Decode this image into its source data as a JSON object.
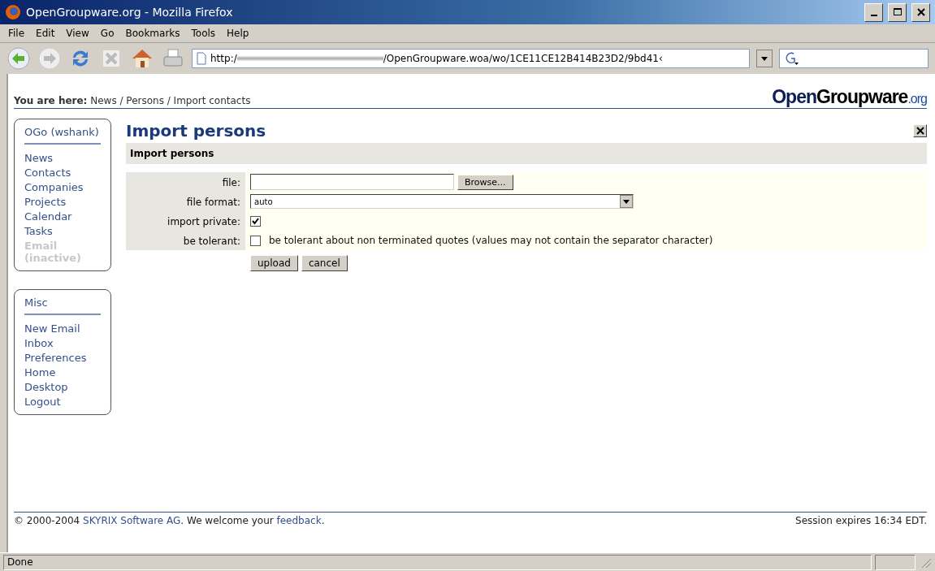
{
  "window": {
    "title": "OpenGroupware.org - Mozilla Firefox"
  },
  "menu": [
    "File",
    "Edit",
    "View",
    "Go",
    "Bookmarks",
    "Tools",
    "Help"
  ],
  "address": {
    "prefix": "http:/",
    "suffix": "/OpenGroupware.woa/wo/1CE11CE12B414B23D2/9bd41‹"
  },
  "breadcrumb": {
    "label": "You are here:",
    "path": "News / Persons / Import contacts"
  },
  "logo": [
    "Open",
    "Groupware",
    ".org"
  ],
  "sidebar": [
    {
      "title": "OGo (wshank)",
      "items": [
        {
          "label": "News",
          "disabled": false
        },
        {
          "label": "Contacts",
          "disabled": false
        },
        {
          "label": "Companies",
          "disabled": false
        },
        {
          "label": "Projects",
          "disabled": false
        },
        {
          "label": "Calendar",
          "disabled": false
        },
        {
          "label": "Tasks",
          "disabled": false
        },
        {
          "label": "Email (inactive)",
          "disabled": true
        }
      ]
    },
    {
      "title": "Misc",
      "items": [
        {
          "label": "New Email",
          "disabled": false
        },
        {
          "label": "Inbox",
          "disabled": false
        },
        {
          "label": "Preferences",
          "disabled": false
        },
        {
          "label": "Home",
          "disabled": false
        },
        {
          "label": "Desktop",
          "disabled": false
        },
        {
          "label": "Logout",
          "disabled": false
        }
      ]
    }
  ],
  "page": {
    "title": "Import persons",
    "section": "Import persons"
  },
  "form": [
    {
      "kind": "file",
      "label": "file:",
      "button": "Browse..."
    },
    {
      "kind": "select",
      "label": "file format:",
      "value": "auto"
    },
    {
      "kind": "checkbox",
      "label": "import private:",
      "checked": true
    },
    {
      "kind": "checkbox",
      "label": "be tolerant:",
      "checked": false,
      "text": "be tolerant about non terminated quotes (values may not contain the separator character)"
    }
  ],
  "buttons": [
    "upload",
    "cancel"
  ],
  "footer": {
    "segments": [
      {
        "kind": "text",
        "text": "© 2000-2004 "
      },
      {
        "kind": "link",
        "text": "SKYRIX Software AG"
      },
      {
        "kind": "text",
        "text": ". We welcome your "
      },
      {
        "kind": "link",
        "text": "feedback"
      },
      {
        "kind": "text",
        "text": "."
      }
    ],
    "session": "Session expires 16:34 EDT."
  },
  "status_bar": {
    "text": "Done"
  }
}
